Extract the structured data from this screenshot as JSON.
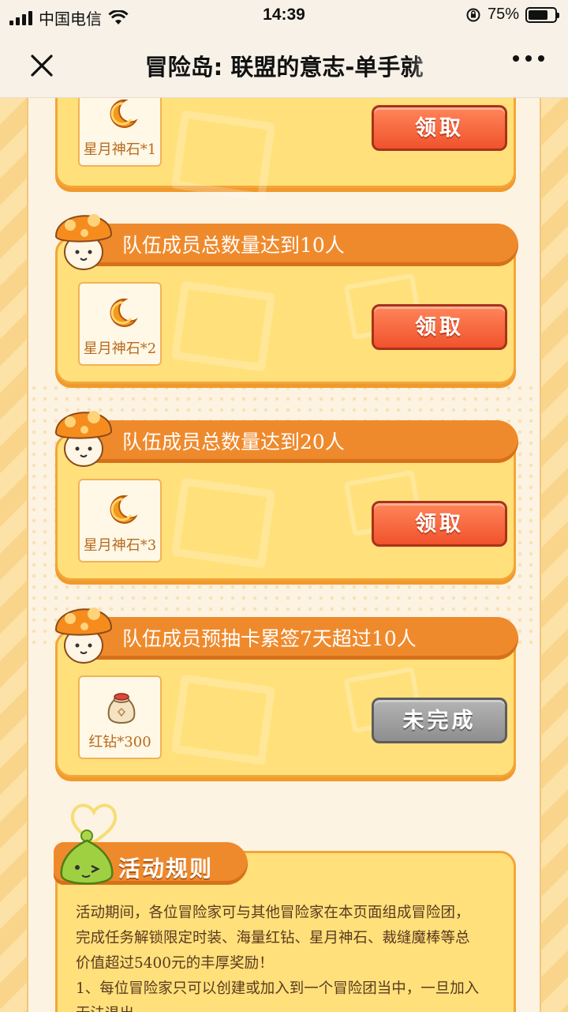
{
  "status_bar": {
    "carrier": "中国电信",
    "time": "14:39",
    "battery_text": "75%",
    "battery_level": 0.75
  },
  "nav": {
    "title": "冒险岛: 联盟的意志-单手就"
  },
  "tasks": [
    {
      "title": "",
      "reward_label": "星月神石*1",
      "reward_icon": "moon-stone-icon",
      "button_label": "领取",
      "state": "claim"
    },
    {
      "title": "队伍成员总数量达到10人",
      "reward_label": "星月神石*2",
      "reward_icon": "moon-stone-icon",
      "button_label": "领取",
      "state": "claim"
    },
    {
      "title": "队伍成员总数量达到20人",
      "reward_label": "星月神石*3",
      "reward_icon": "moon-stone-icon",
      "button_label": "领取",
      "state": "claim"
    },
    {
      "title": "队伍成员预抽卡累签7天超过10人",
      "reward_label": "红钻*300",
      "reward_icon": "red-diamond-bag-icon",
      "button_label": "未完成",
      "state": "pending"
    }
  ],
  "rules": {
    "title": "活动规则",
    "lines": [
      "活动期间，各位冒险家可与其他冒险家在本页面组成冒险团，",
      "完成任务解锁限定时装、海量红钻、星月神石、裁缝魔棒等总",
      "价值超过5400元的丰厚奖励！",
      "1、每位冒险家只可以创建或加入到一个冒险团当中，一旦加入",
      "无法退出"
    ]
  },
  "colors": {
    "card_fill": "#ffe07a",
    "ribbon": "#ef8a2c",
    "claim_button": "#f0532d",
    "pending_button": "#8e8e8e"
  }
}
